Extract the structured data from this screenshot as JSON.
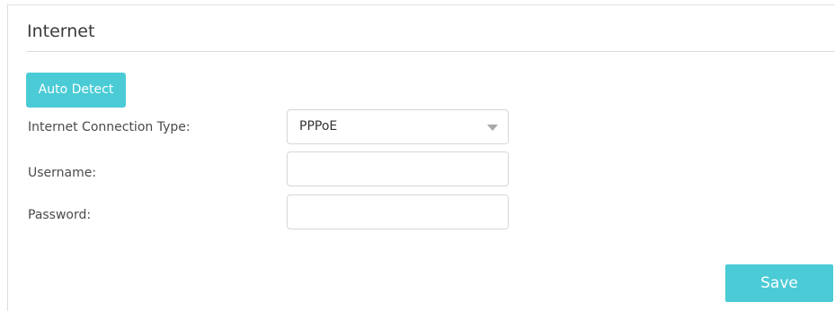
{
  "section": {
    "title": "Internet"
  },
  "actions": {
    "auto_detect_label": "Auto Detect",
    "save_label": "Save"
  },
  "form": {
    "connection_type": {
      "label": "Internet Connection Type:",
      "selected": "PPPoE"
    },
    "username": {
      "label": "Username:",
      "value": "",
      "placeholder": ""
    },
    "password": {
      "label": "Password:",
      "value": "",
      "placeholder": ""
    }
  },
  "colors": {
    "accent": "#4acbd6",
    "label_text": "#4a4a4a",
    "border": "#d7d7d7"
  },
  "icons": {
    "dropdown": "caret-down-icon"
  }
}
